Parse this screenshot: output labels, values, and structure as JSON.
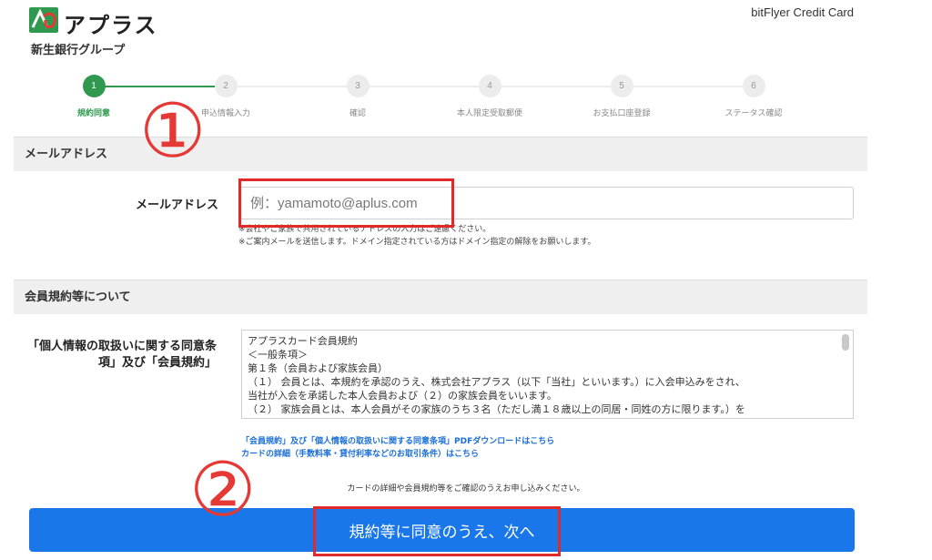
{
  "header": {
    "logo_text": "アプラス",
    "logo_sub": "新生銀行グループ",
    "brand": "bitFlyer Credit Card"
  },
  "steps": [
    {
      "num": "1",
      "label": "規約同意",
      "active": true
    },
    {
      "num": "2",
      "label": "申込情報入力",
      "active": false
    },
    {
      "num": "3",
      "label": "確認",
      "active": false
    },
    {
      "num": "4",
      "label": "本人限定受取郵便",
      "active": false
    },
    {
      "num": "5",
      "label": "お支払口座登録",
      "active": false
    },
    {
      "num": "6",
      "label": "ステータス確認",
      "active": false
    }
  ],
  "email_section": {
    "title": "メールアドレス",
    "label": "メールアドレス",
    "placeholder": "例：yamamoto@aplus.com",
    "value": "",
    "notes": [
      "※会社やご家族で共用されているアドレスの入力はご遠慮ください。",
      "※ご案内メールを送信します。ドメイン指定されている方はドメイン指定の解除をお願いします。"
    ]
  },
  "terms_section": {
    "title": "会員規約等について",
    "label_line1": "「個人情報の取扱いに関する同意条",
    "label_line2": "項」及び「会員規約」",
    "terms_lines": [
      "アプラスカード会員規約",
      "＜一般条項＞",
      "第１条（会員および家族会員）",
      "（１） 会員とは、本規約を承認のうえ、株式会社アプラス（以下「当社」といいます。）に入会申込みをされ、",
      "当社が入会を承諾した本人会員および（２）の家族会員をいいます。",
      "（２） 家族会員とは、本人会員がその家族のうち３名（ただし満１８歳以上の同居・同姓の方に限ります。）を"
    ],
    "link_pdf": "「会員規約」及び「個人情報の取扱いに関する同意条項」PDFダウンロードはこちら",
    "link_details": "カードの詳細（手数料率・貸付利率などのお取引条件）はこちら"
  },
  "hint": "カードの詳細や会員規約等をご確認のうえお申し込みください。",
  "submit_label": "規約等に同意のうえ、次へ",
  "annotations": {
    "one": "①",
    "two": "②"
  },
  "colors": {
    "accent_green": "#2f9a4f",
    "button_blue": "#1977ea",
    "annotation_red": "#e02a2a"
  }
}
